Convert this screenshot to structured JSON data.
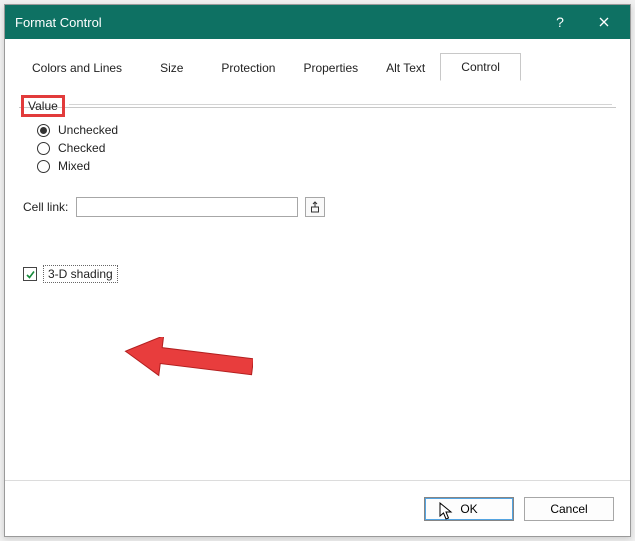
{
  "titlebar": {
    "title": "Format Control"
  },
  "tabs": {
    "t0": "Colors and Lines",
    "t1": "Size",
    "t2": "Protection",
    "t3": "Properties",
    "t4": "Alt Text",
    "t5": "Control"
  },
  "group": {
    "value_label": "Value"
  },
  "radios": {
    "unchecked": "Unchecked",
    "checked": "Checked",
    "mixed": "Mixed"
  },
  "cell_link": {
    "label": "Cell link:",
    "value": "",
    "placeholder": ""
  },
  "shading": {
    "label": "3-D shading",
    "checked": true
  },
  "buttons": {
    "ok": "OK",
    "cancel": "Cancel"
  }
}
